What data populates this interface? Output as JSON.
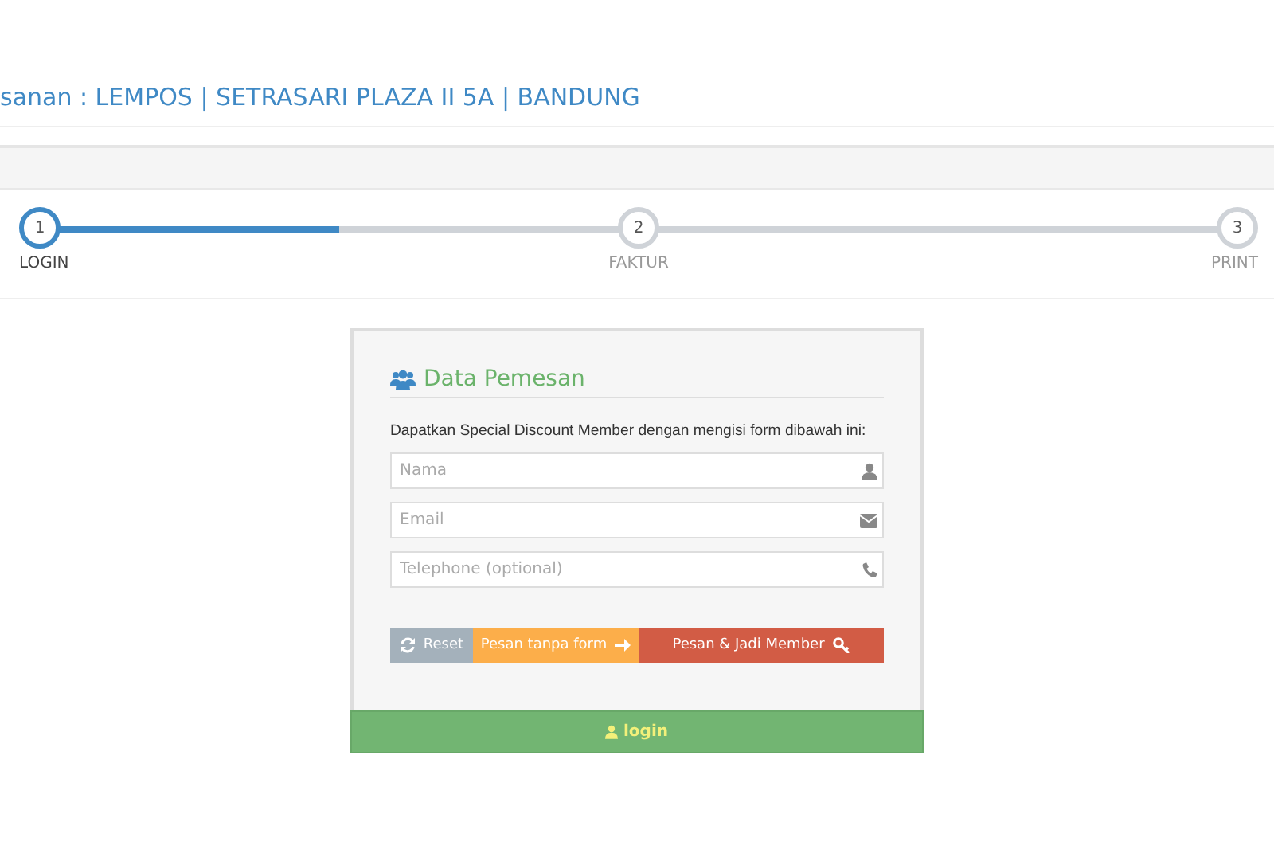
{
  "header": {
    "title": "sanan : LEMPOS | SETRASARI PLAZA II 5A | BANDUNG"
  },
  "stepper": {
    "level": 0.25,
    "steps": [
      {
        "number": "1",
        "label": "LOGIN",
        "selected": true
      },
      {
        "number": "2",
        "label": "FAKTUR",
        "selected": false
      },
      {
        "number": "3",
        "label": "PRINT",
        "selected": false
      }
    ]
  },
  "form": {
    "title": "Data Pemesan",
    "intro": "Dapatkan Special Discount Member dengan mengisi form dibawah ini:",
    "fields": [
      {
        "placeholder": "Nama",
        "kind": "user"
      },
      {
        "placeholder": "Email",
        "kind": "email"
      },
      {
        "placeholder": "Telephone (optional)",
        "kind": "phone"
      }
    ],
    "buttons": [
      {
        "label": "Reset",
        "kind": "reset"
      },
      {
        "label": "Pesan tanpa form",
        "kind": "guest"
      },
      {
        "label": "Pesan & Jadi Member",
        "kind": "member"
      }
    ],
    "footer": {
      "label": "login"
    }
  }
}
